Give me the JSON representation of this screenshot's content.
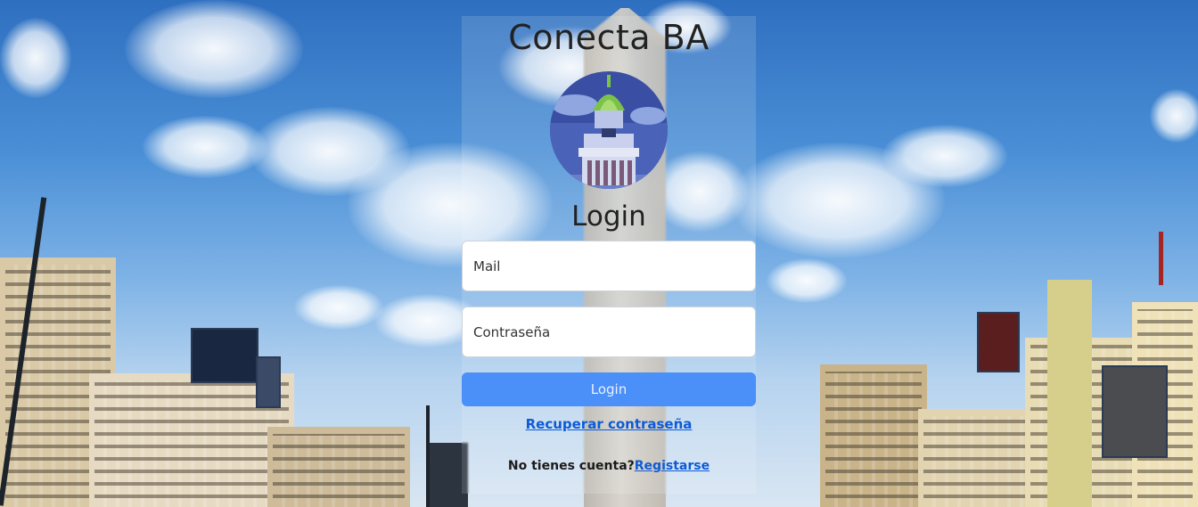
{
  "app": {
    "title": "Conecta BA"
  },
  "form": {
    "heading": "Login",
    "mail_placeholder": "Mail",
    "password_placeholder": "Contraseña",
    "login_button": "Login",
    "recover_link": "Recuperar contraseña",
    "signup_prompt": "No tienes cuenta?",
    "signup_link": "Registarse"
  },
  "colors": {
    "button": "#4b8ff8",
    "link": "#0d5bd6",
    "title_text": "#222222"
  },
  "icons": {
    "logo": "congress-building-logo"
  }
}
